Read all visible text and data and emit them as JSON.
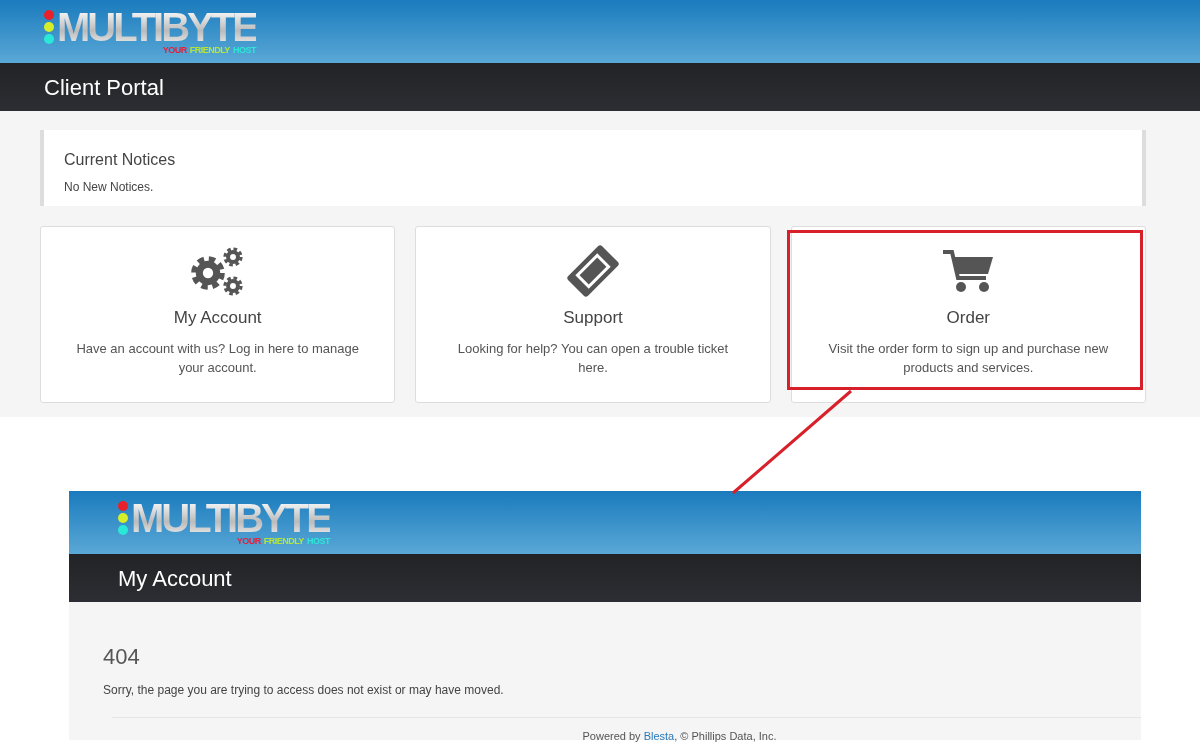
{
  "portal": {
    "logo": {
      "wordmark": "MULTIBYTE",
      "tagline": [
        {
          "text": "YOUR",
          "color": "#e3213b"
        },
        {
          "text": "FRIENDLY",
          "color": "#b8e636"
        },
        {
          "text": "HOST",
          "color": "#2ee6d6"
        }
      ]
    },
    "title": "Client Portal",
    "notices": {
      "heading": "Current Notices",
      "text": "No New Notices."
    },
    "cards": [
      {
        "title": "My Account",
        "text": "Have an account with us? Log in here to manage your account.",
        "highlighted": false
      },
      {
        "title": "Support",
        "text": "Looking for help? You can open a trouble ticket here.",
        "highlighted": false
      },
      {
        "title": "Order",
        "text": "Visit the order form to sign up and purchase new products and services.",
        "highlighted": true
      }
    ]
  },
  "error_page": {
    "logo": {
      "wordmark": "MULTIBYTE",
      "tagline": [
        {
          "text": "YOUR",
          "color": "#e3213b"
        },
        {
          "text": "FRIENDLY",
          "color": "#b8e636"
        },
        {
          "text": "HOST",
          "color": "#2ee6d6"
        }
      ]
    },
    "title": "My Account",
    "code": "404",
    "message": "Sorry, the page you are trying to access does not exist or may have moved.",
    "footer": {
      "prefix": "Powered by ",
      "link": "Blesta",
      "suffix": ", © Phillips Data, Inc."
    }
  }
}
